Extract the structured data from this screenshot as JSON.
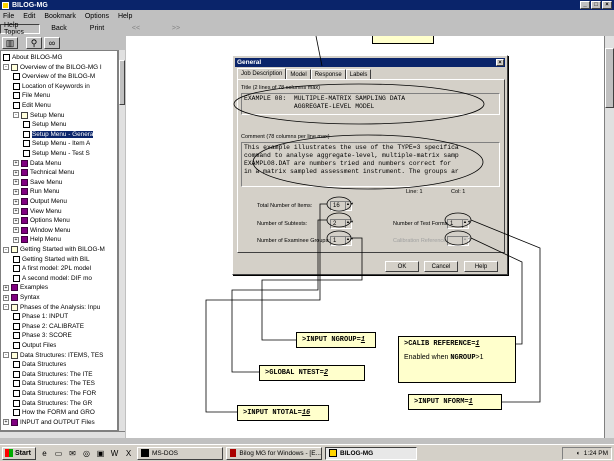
{
  "window": {
    "title": "BILOG-MG"
  },
  "menu": [
    "File",
    "Edit",
    "Bookmark",
    "Options",
    "Help"
  ],
  "toolbar": [
    {
      "label": "Help Topics",
      "state": "pressed"
    },
    {
      "label": "Back",
      "state": "normal"
    },
    {
      "label": "Print",
      "state": "normal"
    },
    {
      "label": "<<",
      "state": "dim"
    },
    {
      "label": ">>",
      "state": "dim"
    }
  ],
  "toolbar2_icons": [
    "book-icon",
    "magnifier-icon",
    "binoculars-icon"
  ],
  "tree": [
    {
      "label": "About BILOG-MG",
      "level": 0,
      "icon": "page",
      "pm": ""
    },
    {
      "label": "Overview of the BILOG-MG I",
      "level": 0,
      "icon": "open",
      "pm": "-"
    },
    {
      "label": "Overview of the BILOG-M",
      "level": 1,
      "icon": "page",
      "pm": ""
    },
    {
      "label": "Location of Keywords in",
      "level": 1,
      "icon": "page",
      "pm": ""
    },
    {
      "label": "File Menu",
      "level": 1,
      "icon": "page",
      "pm": ""
    },
    {
      "label": "Edit Menu",
      "level": 1,
      "icon": "page",
      "pm": ""
    },
    {
      "label": "Setup Menu",
      "level": 1,
      "icon": "open",
      "pm": "-"
    },
    {
      "label": "Setup Menu",
      "level": 2,
      "icon": "page",
      "pm": ""
    },
    {
      "label": "Setup Menu - Genera",
      "level": 2,
      "icon": "page",
      "pm": "",
      "selected": true
    },
    {
      "label": "Setup Menu - Item A",
      "level": 2,
      "icon": "page",
      "pm": ""
    },
    {
      "label": "Setup Menu - Test S",
      "level": 2,
      "icon": "page",
      "pm": ""
    },
    {
      "label": "Data Menu",
      "level": 1,
      "icon": "book",
      "pm": "+"
    },
    {
      "label": "Technical Menu",
      "level": 1,
      "icon": "book",
      "pm": "+"
    },
    {
      "label": "Save Menu",
      "level": 1,
      "icon": "book",
      "pm": "+"
    },
    {
      "label": "Run Menu",
      "level": 1,
      "icon": "book",
      "pm": "+"
    },
    {
      "label": "Output Menu",
      "level": 1,
      "icon": "book",
      "pm": "+"
    },
    {
      "label": "View Menu",
      "level": 1,
      "icon": "book",
      "pm": "+"
    },
    {
      "label": "Options Menu",
      "level": 1,
      "icon": "book",
      "pm": "+"
    },
    {
      "label": "Window Menu",
      "level": 1,
      "icon": "book",
      "pm": "+"
    },
    {
      "label": "Help Menu",
      "level": 1,
      "icon": "book",
      "pm": "+"
    },
    {
      "label": "Getting Started with BILOG-M",
      "level": 0,
      "icon": "open",
      "pm": "-"
    },
    {
      "label": "Getting Started with BIL",
      "level": 1,
      "icon": "page",
      "pm": ""
    },
    {
      "label": "A first model: 2PL model",
      "level": 1,
      "icon": "page",
      "pm": ""
    },
    {
      "label": "A second model: DIF mo",
      "level": 1,
      "icon": "page",
      "pm": ""
    },
    {
      "label": "Examples",
      "level": 0,
      "icon": "book",
      "pm": "+"
    },
    {
      "label": "Syntax",
      "level": 0,
      "icon": "book",
      "pm": "+"
    },
    {
      "label": "Phases of the Analysis: Inpu",
      "level": 0,
      "icon": "open",
      "pm": "-"
    },
    {
      "label": "Phase 1: INPUT",
      "level": 1,
      "icon": "page",
      "pm": ""
    },
    {
      "label": "Phase 2: CALIBRATE",
      "level": 1,
      "icon": "page",
      "pm": ""
    },
    {
      "label": "Phase 3: SCORE",
      "level": 1,
      "icon": "page",
      "pm": ""
    },
    {
      "label": "Output Files",
      "level": 1,
      "icon": "page",
      "pm": ""
    },
    {
      "label": "Data Structures: ITEMS, TES",
      "level": 0,
      "icon": "open",
      "pm": "-"
    },
    {
      "label": "Data Structures",
      "level": 1,
      "icon": "page",
      "pm": ""
    },
    {
      "label": "Data Structures: The ITE",
      "level": 1,
      "icon": "page",
      "pm": ""
    },
    {
      "label": "Data Structures: The TES",
      "level": 1,
      "icon": "page",
      "pm": ""
    },
    {
      "label": "Data Structures: The FOR",
      "level": 1,
      "icon": "page",
      "pm": ""
    },
    {
      "label": "Data Structures: The GR",
      "level": 1,
      "icon": "page",
      "pm": ""
    },
    {
      "label": "How the FORM and GRO",
      "level": 1,
      "icon": "page",
      "pm": ""
    },
    {
      "label": "INPUT and OUTPUT Files",
      "level": 0,
      "icon": "book",
      "pm": "+"
    }
  ],
  "dialog": {
    "title": "General",
    "tabs": [
      "Job Description",
      "Model",
      "Response",
      "Labels"
    ],
    "title_label": "Title (2 lines of 78 columns max)",
    "title_text": "EXAMPLE 08:  MULTIPLE-MATRIX SAMPLING DATA\n             AGGREGATE-LEVEL MODEL",
    "comment_label": "Comment (78 columns per line max)",
    "comment_text": "This example illustrates the use of the TYPE=3 specifica\ncommand to analyse aggregate-level, multiple-matrix samp\nEXAMPL08.DAT are numbers tried and numbers correct for\nin a matrix sampled assessment instrument. The groups ar",
    "line_label": "Line: 1",
    "col_label": "Col: 1",
    "fields": [
      {
        "label": "Total Number of Items:",
        "value": "16"
      },
      {
        "label": "Number of Subtests:",
        "value": "2"
      },
      {
        "label": "Number of Examinee Groups:",
        "value": "1"
      },
      {
        "label": "Number of Test Forms:",
        "value": "1"
      },
      {
        "label": "Calibration Reference:",
        "value": ""
      }
    ],
    "buttons": [
      "OK",
      "Cancel",
      "Help"
    ]
  },
  "callouts": {
    "ngroup": {
      "prefix": ">INPUT NGROUP=",
      "value": "1"
    },
    "ntest": {
      "prefix": ">GLOBAL NTEST=",
      "value": "2"
    },
    "ntotal": {
      "prefix": ">INPUT NTOTAL=",
      "value": "16"
    },
    "calib": {
      "prefix": ">CALIB REFERENCE=",
      "value": "1",
      "note_prefix": "Enabled when ",
      "note_key": "NGROUP",
      "note_suffix": ">1"
    },
    "nform": {
      "prefix": ">INPUT NFORM=",
      "value": "1"
    }
  },
  "taskbar": {
    "start": "Start",
    "tasks": [
      {
        "label": "MS-DOS",
        "active": false
      },
      {
        "label": "Bilog MG for Windows - [E...",
        "active": false
      },
      {
        "label": "BILOG-MG",
        "active": true
      }
    ],
    "clock": "1:24 PM"
  }
}
